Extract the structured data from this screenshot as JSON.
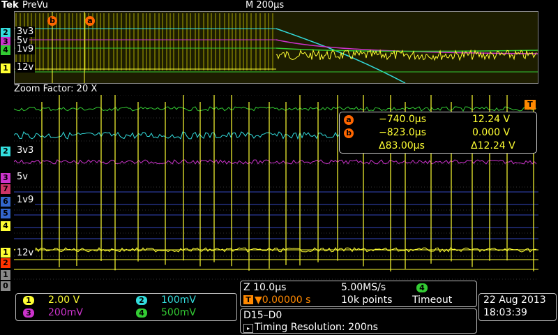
{
  "header": {
    "brand": "Tek",
    "mode": "PreVu",
    "timebase": "M 200µs"
  },
  "overview": {
    "labels": {
      "ch2": "3v3",
      "ch3": "5v",
      "ch4": "1v9",
      "ch1": "12v"
    },
    "cursor_a": "a",
    "cursor_b": "b",
    "trigger": "T"
  },
  "zoom": {
    "title": "Zoom Factor: 20 X",
    "labels": {
      "ch2": "3v3",
      "ch3": "5v",
      "ch4": "1v9",
      "ch1": "12v"
    },
    "side_markers": [
      "2",
      "3",
      "7",
      "6",
      "5",
      "4",
      "1",
      "2",
      "1",
      "0"
    ]
  },
  "cursors": {
    "a_time": "−740.0µs",
    "a_value": "12.24 V",
    "b_time": "−823.0µs",
    "b_value": "0.000 V",
    "delta_time": "Δ83.00µs",
    "delta_value": "Δ12.24 V",
    "a_badge": "a",
    "b_badge": "b"
  },
  "channels": [
    {
      "num": "1",
      "scale": "2.00 V",
      "color": "#ffff33"
    },
    {
      "num": "2",
      "scale": "100mV",
      "color": "#33dddd"
    },
    {
      "num": "3",
      "scale": "200mV",
      "color": "#cc33cc"
    },
    {
      "num": "4",
      "scale": "500mV",
      "color": "#33cc33"
    }
  ],
  "acquisition": {
    "zoom_scale": "Z 10.0µs",
    "sample_rate": "5.00MS/s",
    "trigger_pos": "▼0.00000 s",
    "record_length": "10k points",
    "trigger_channel": "4",
    "trigger_mode": "Timeout"
  },
  "digital": {
    "channels": "D15–D0",
    "resolution": "Timing Resolution: 200ns"
  },
  "datetime": {
    "date": "22 Aug 2013",
    "time": "18:03:39"
  }
}
